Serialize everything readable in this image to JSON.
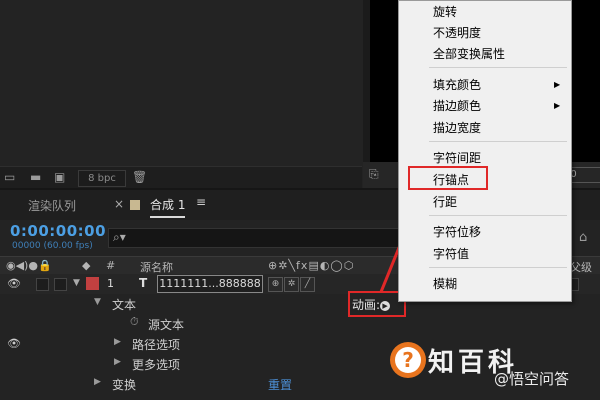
{
  "project_panel": {
    "bpc": "8 bpc"
  },
  "viewer": {
    "zoom": "00"
  },
  "tabs": {
    "render_queue": "渲染队列",
    "close": "×",
    "comp": "合成 1",
    "menu": "≡"
  },
  "timeline": {
    "timecode": "0:00:00:00",
    "fps": "00000 (60.00 fps)",
    "columns": {
      "number": "#",
      "source_name": "源名称",
      "parent": "父级"
    },
    "layer": {
      "index": "1",
      "type": "T",
      "name": "1111111...888888",
      "label_color": "#c24040"
    },
    "properties": {
      "text": "文本",
      "animate": "动画:",
      "source_text": "源文本",
      "path_options": "路径选项",
      "more_options": "更多选项",
      "transform": "变换",
      "reset": "重置"
    }
  },
  "context_menu": {
    "items": [
      "旋转",
      "不透明度",
      "全部变换属性",
      "填充颜色",
      "描边颜色",
      "描边宽度",
      "字符间距",
      "行锚点",
      "行距",
      "字符位移",
      "字符值",
      "模糊"
    ]
  },
  "annotation": {
    "highlight_color": "#e02828",
    "highlighted_item": "行锚点"
  },
  "watermark": {
    "brand": "知百科",
    "handle": "@悟空问答"
  }
}
